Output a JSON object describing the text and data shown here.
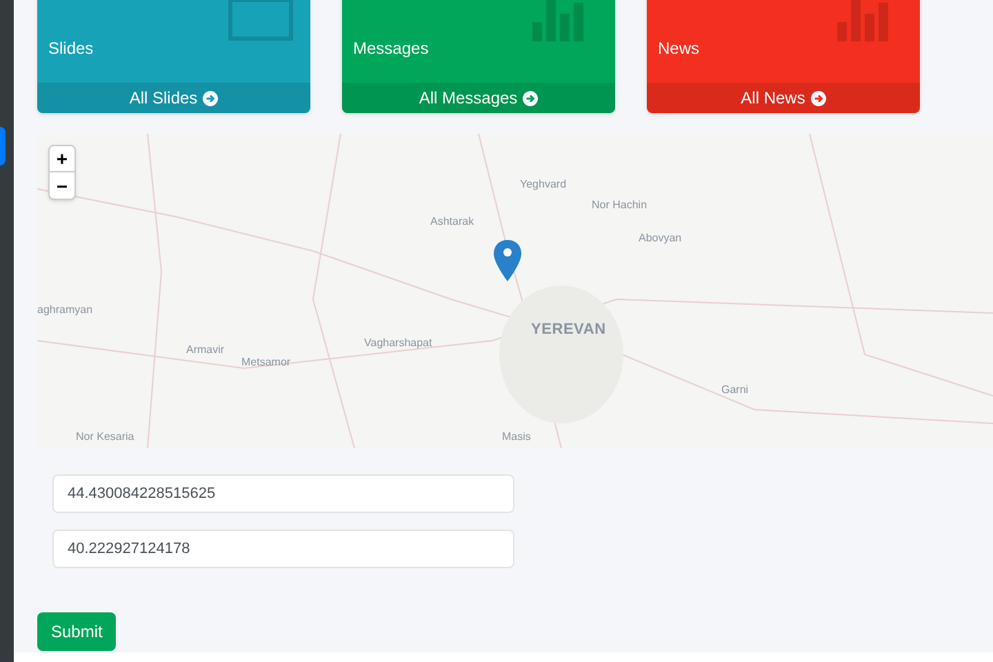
{
  "cards": [
    {
      "label": "Slides",
      "link": "All Slides",
      "color": "#17a2b8"
    },
    {
      "label": "Messages",
      "link": "All Messages",
      "color": "#00a65a"
    },
    {
      "label": "News",
      "link": "All News",
      "color": "#f32f1f"
    }
  ],
  "map": {
    "zoom_in": "+",
    "zoom_out": "−",
    "places": [
      {
        "name": "Yeghvard",
        "kind": "town"
      },
      {
        "name": "Nor Hachin",
        "kind": "town"
      },
      {
        "name": "Ashtarak",
        "kind": "town"
      },
      {
        "name": "Abovyan",
        "kind": "town"
      },
      {
        "name": "aghramyan",
        "kind": "town"
      },
      {
        "name": "YEREVAN",
        "kind": "city"
      },
      {
        "name": "Vagharshapat",
        "kind": "town"
      },
      {
        "name": "Armavir",
        "kind": "town"
      },
      {
        "name": "Metsamor",
        "kind": "town"
      },
      {
        "name": "Garni",
        "kind": "town"
      },
      {
        "name": "Nor Kesaria",
        "kind": "town"
      },
      {
        "name": "Masis",
        "kind": "town"
      }
    ]
  },
  "form": {
    "fields": [
      {
        "value": "44.430084228515625"
      },
      {
        "value": "40.222927124178"
      }
    ],
    "submit": "Submit"
  }
}
